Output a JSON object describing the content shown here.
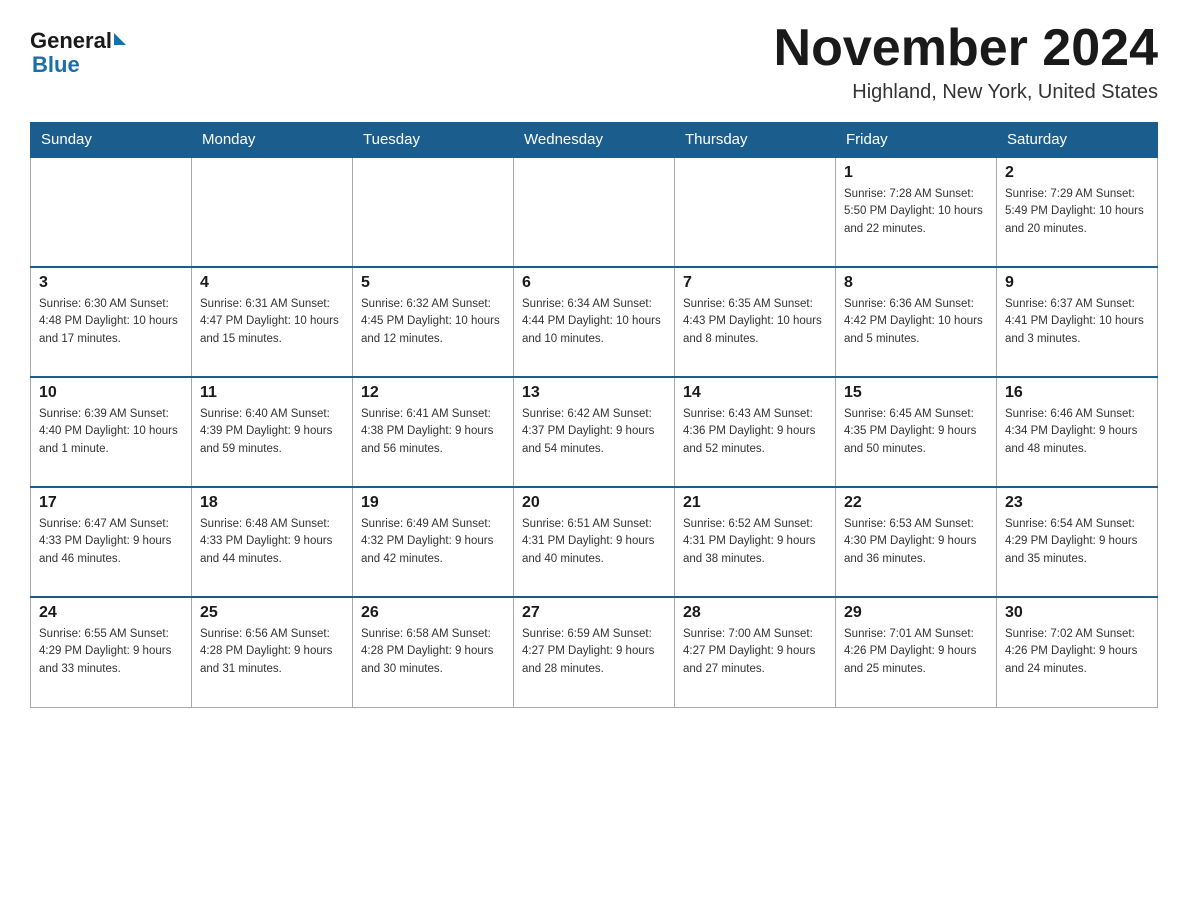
{
  "header": {
    "logo_general": "General",
    "logo_blue": "Blue",
    "month_title": "November 2024",
    "location": "Highland, New York, United States"
  },
  "weekdays": [
    "Sunday",
    "Monday",
    "Tuesday",
    "Wednesday",
    "Thursday",
    "Friday",
    "Saturday"
  ],
  "weeks": [
    [
      {
        "day": "",
        "info": ""
      },
      {
        "day": "",
        "info": ""
      },
      {
        "day": "",
        "info": ""
      },
      {
        "day": "",
        "info": ""
      },
      {
        "day": "",
        "info": ""
      },
      {
        "day": "1",
        "info": "Sunrise: 7:28 AM\nSunset: 5:50 PM\nDaylight: 10 hours and 22 minutes."
      },
      {
        "day": "2",
        "info": "Sunrise: 7:29 AM\nSunset: 5:49 PM\nDaylight: 10 hours and 20 minutes."
      }
    ],
    [
      {
        "day": "3",
        "info": "Sunrise: 6:30 AM\nSunset: 4:48 PM\nDaylight: 10 hours and 17 minutes."
      },
      {
        "day": "4",
        "info": "Sunrise: 6:31 AM\nSunset: 4:47 PM\nDaylight: 10 hours and 15 minutes."
      },
      {
        "day": "5",
        "info": "Sunrise: 6:32 AM\nSunset: 4:45 PM\nDaylight: 10 hours and 12 minutes."
      },
      {
        "day": "6",
        "info": "Sunrise: 6:34 AM\nSunset: 4:44 PM\nDaylight: 10 hours and 10 minutes."
      },
      {
        "day": "7",
        "info": "Sunrise: 6:35 AM\nSunset: 4:43 PM\nDaylight: 10 hours and 8 minutes."
      },
      {
        "day": "8",
        "info": "Sunrise: 6:36 AM\nSunset: 4:42 PM\nDaylight: 10 hours and 5 minutes."
      },
      {
        "day": "9",
        "info": "Sunrise: 6:37 AM\nSunset: 4:41 PM\nDaylight: 10 hours and 3 minutes."
      }
    ],
    [
      {
        "day": "10",
        "info": "Sunrise: 6:39 AM\nSunset: 4:40 PM\nDaylight: 10 hours and 1 minute."
      },
      {
        "day": "11",
        "info": "Sunrise: 6:40 AM\nSunset: 4:39 PM\nDaylight: 9 hours and 59 minutes."
      },
      {
        "day": "12",
        "info": "Sunrise: 6:41 AM\nSunset: 4:38 PM\nDaylight: 9 hours and 56 minutes."
      },
      {
        "day": "13",
        "info": "Sunrise: 6:42 AM\nSunset: 4:37 PM\nDaylight: 9 hours and 54 minutes."
      },
      {
        "day": "14",
        "info": "Sunrise: 6:43 AM\nSunset: 4:36 PM\nDaylight: 9 hours and 52 minutes."
      },
      {
        "day": "15",
        "info": "Sunrise: 6:45 AM\nSunset: 4:35 PM\nDaylight: 9 hours and 50 minutes."
      },
      {
        "day": "16",
        "info": "Sunrise: 6:46 AM\nSunset: 4:34 PM\nDaylight: 9 hours and 48 minutes."
      }
    ],
    [
      {
        "day": "17",
        "info": "Sunrise: 6:47 AM\nSunset: 4:33 PM\nDaylight: 9 hours and 46 minutes."
      },
      {
        "day": "18",
        "info": "Sunrise: 6:48 AM\nSunset: 4:33 PM\nDaylight: 9 hours and 44 minutes."
      },
      {
        "day": "19",
        "info": "Sunrise: 6:49 AM\nSunset: 4:32 PM\nDaylight: 9 hours and 42 minutes."
      },
      {
        "day": "20",
        "info": "Sunrise: 6:51 AM\nSunset: 4:31 PM\nDaylight: 9 hours and 40 minutes."
      },
      {
        "day": "21",
        "info": "Sunrise: 6:52 AM\nSunset: 4:31 PM\nDaylight: 9 hours and 38 minutes."
      },
      {
        "day": "22",
        "info": "Sunrise: 6:53 AM\nSunset: 4:30 PM\nDaylight: 9 hours and 36 minutes."
      },
      {
        "day": "23",
        "info": "Sunrise: 6:54 AM\nSunset: 4:29 PM\nDaylight: 9 hours and 35 minutes."
      }
    ],
    [
      {
        "day": "24",
        "info": "Sunrise: 6:55 AM\nSunset: 4:29 PM\nDaylight: 9 hours and 33 minutes."
      },
      {
        "day": "25",
        "info": "Sunrise: 6:56 AM\nSunset: 4:28 PM\nDaylight: 9 hours and 31 minutes."
      },
      {
        "day": "26",
        "info": "Sunrise: 6:58 AM\nSunset: 4:28 PM\nDaylight: 9 hours and 30 minutes."
      },
      {
        "day": "27",
        "info": "Sunrise: 6:59 AM\nSunset: 4:27 PM\nDaylight: 9 hours and 28 minutes."
      },
      {
        "day": "28",
        "info": "Sunrise: 7:00 AM\nSunset: 4:27 PM\nDaylight: 9 hours and 27 minutes."
      },
      {
        "day": "29",
        "info": "Sunrise: 7:01 AM\nSunset: 4:26 PM\nDaylight: 9 hours and 25 minutes."
      },
      {
        "day": "30",
        "info": "Sunrise: 7:02 AM\nSunset: 4:26 PM\nDaylight: 9 hours and 24 minutes."
      }
    ]
  ]
}
